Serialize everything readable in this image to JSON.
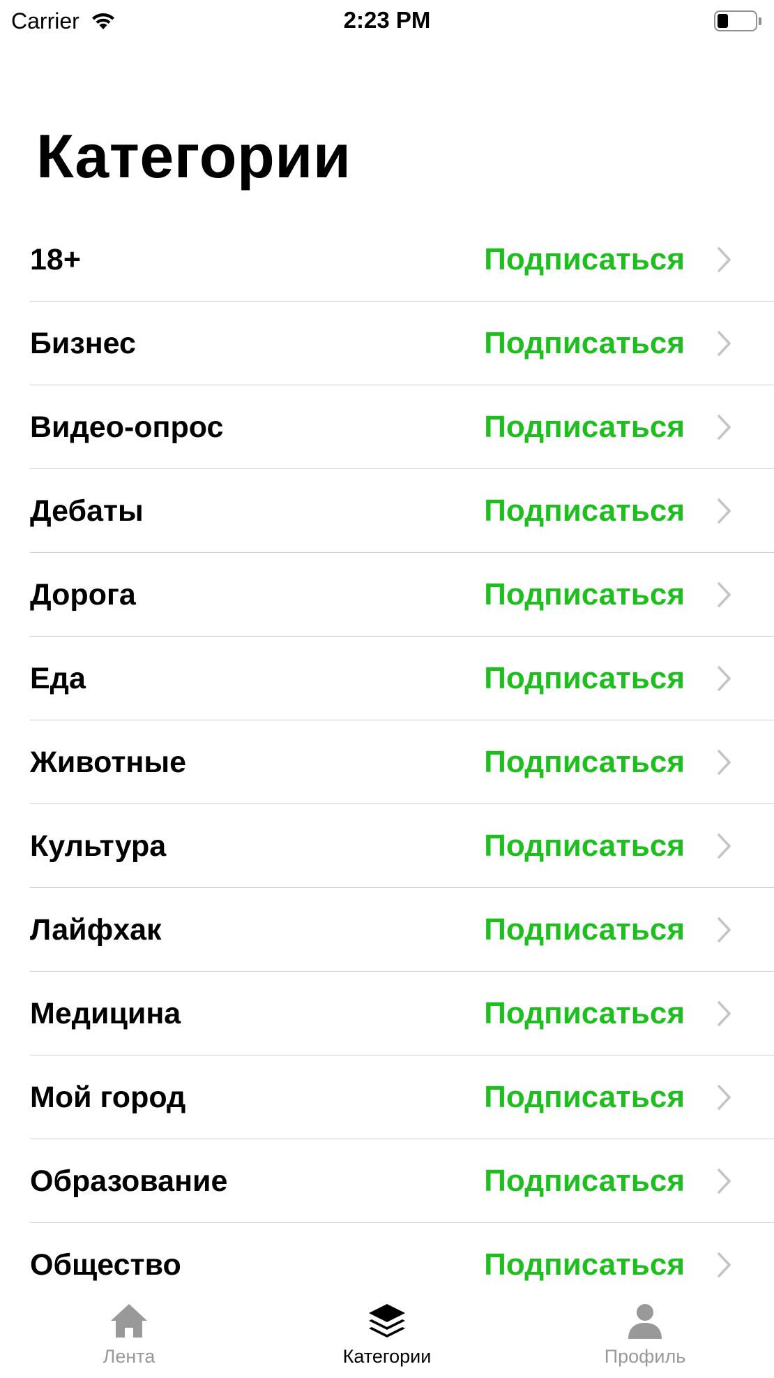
{
  "status_bar": {
    "carrier": "Carrier",
    "time": "2:23 PM"
  },
  "title": "Категории",
  "categories": [
    {
      "label": "18+",
      "action": "Подписаться"
    },
    {
      "label": "Бизнес",
      "action": "Подписаться"
    },
    {
      "label": "Видео-опрос",
      "action": "Подписаться"
    },
    {
      "label": "Дебаты",
      "action": "Подписаться"
    },
    {
      "label": "Дорога",
      "action": "Подписаться"
    },
    {
      "label": "Еда",
      "action": "Подписаться"
    },
    {
      "label": "Животные",
      "action": "Подписаться"
    },
    {
      "label": "Культура",
      "action": "Подписаться"
    },
    {
      "label": "Лайфхак",
      "action": "Подписаться"
    },
    {
      "label": "Медицина",
      "action": "Подписаться"
    },
    {
      "label": "Мой город",
      "action": "Подписаться"
    },
    {
      "label": "Образование",
      "action": "Подписаться"
    },
    {
      "label": "Общество",
      "action": "Подписаться"
    }
  ],
  "tab_bar": {
    "tabs": [
      {
        "label": "Лента",
        "icon": "home-icon",
        "active": false
      },
      {
        "label": "Категории",
        "icon": "layers-icon",
        "active": true
      },
      {
        "label": "Профиль",
        "icon": "person-icon",
        "active": false
      }
    ]
  },
  "colors": {
    "accent": "#1fbe1f",
    "inactive_tab": "#999999",
    "separator": "#cfcfd3"
  }
}
